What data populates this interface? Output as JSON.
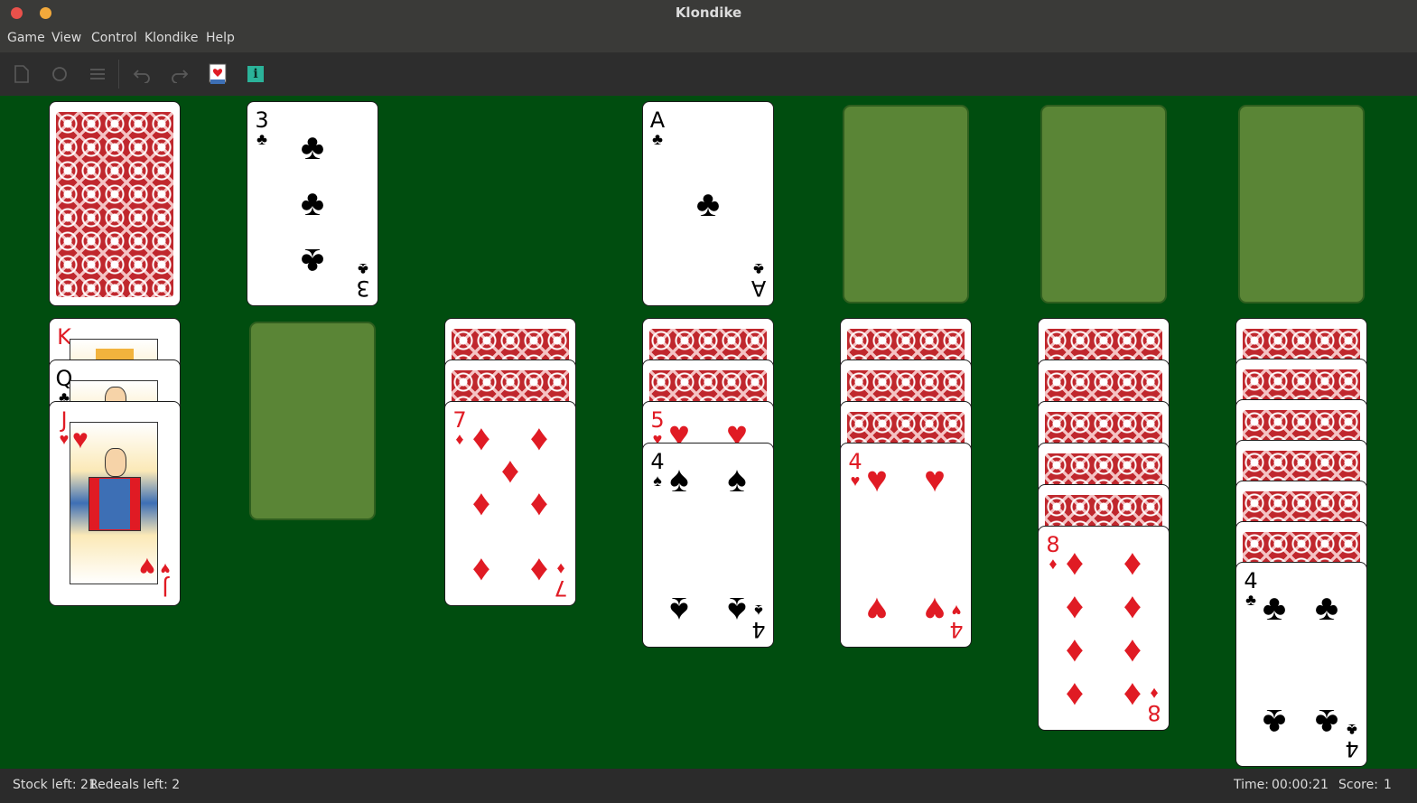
{
  "window": {
    "title": "Klondike",
    "close_color": "#e9514b",
    "minimize_color": "#f2a93b"
  },
  "menu": {
    "items": [
      "Game",
      "View",
      "Control",
      "Klondike",
      "Help"
    ]
  },
  "toolbar": {
    "buttons": [
      {
        "icon": "new-game-icon",
        "enabled": false
      },
      {
        "icon": "restart-icon",
        "enabled": false
      },
      {
        "icon": "select-game-icon",
        "enabled": false
      },
      {
        "icon": "undo-icon",
        "enabled": false
      },
      {
        "icon": "redo-icon",
        "enabled": false
      },
      {
        "icon": "hint-icon",
        "enabled": true
      },
      {
        "icon": "info-icon",
        "enabled": true
      }
    ],
    "info_glyph": "i",
    "info_color": "#2bb39a"
  },
  "colors": {
    "felt": "#004d0f",
    "empty_slot": "#5a8536",
    "card_back": "#c0272d",
    "red_suit": "#e01b24"
  },
  "board": {
    "stock": {
      "cards": "face-down"
    },
    "waste": {
      "rank": "3",
      "suit": "♣"
    },
    "foundations": [
      {
        "rank": "A",
        "suit": "♣"
      },
      null,
      null,
      null
    ],
    "tableau": [
      {
        "face_down": 0,
        "face_up": [
          {
            "rank": "K",
            "suit": "♠"
          },
          {
            "rank": "Q",
            "suit": "♣"
          },
          {
            "rank": "J",
            "suit": "♥"
          }
        ]
      },
      {
        "face_down": 0,
        "face_up": []
      },
      {
        "face_down": 2,
        "face_up": [
          {
            "rank": "7",
            "suit": "♦"
          }
        ]
      },
      {
        "face_down": 2,
        "face_up": [
          {
            "rank": "5",
            "suit": "♥"
          },
          {
            "rank": "4",
            "suit": "♠"
          }
        ]
      },
      {
        "face_down": 3,
        "face_up": [
          {
            "rank": "4",
            "suit": "♥"
          }
        ]
      },
      {
        "face_down": 5,
        "face_up": [
          {
            "rank": "8",
            "suit": "♦"
          }
        ]
      },
      {
        "face_down": 6,
        "face_up": [
          {
            "rank": "4",
            "suit": "♣"
          }
        ]
      }
    ]
  },
  "status": {
    "stock_left": "Stock left: 21",
    "redeals_left": "Redeals left: 2",
    "time_label": "Time:",
    "time_value": "00:00:21",
    "score_label": "Score:",
    "score_value": "1"
  }
}
